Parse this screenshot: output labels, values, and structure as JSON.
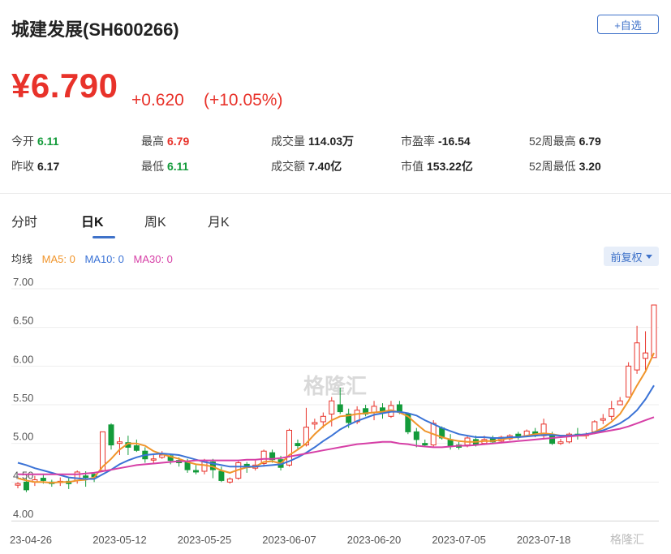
{
  "header": {
    "title": "城建发展(SH600266)",
    "add_button": "+自选"
  },
  "quote": {
    "price": "¥6.790",
    "change": "+0.620",
    "change_pct": "(+10.05%)"
  },
  "stats": [
    {
      "label": "今开",
      "value": "6.11",
      "color": "green"
    },
    {
      "label": "最高",
      "value": "6.79",
      "color": "red"
    },
    {
      "label": "成交量",
      "value": "114.03万",
      "color": "dark"
    },
    {
      "label": "市盈率",
      "value": "-16.54",
      "color": "dark"
    },
    {
      "label": "52周最高",
      "value": "6.79",
      "color": "dark"
    },
    {
      "label": "昨收",
      "value": "6.17",
      "color": "dark"
    },
    {
      "label": "最低",
      "value": "6.11",
      "color": "green"
    },
    {
      "label": "成交额",
      "value": "7.40亿",
      "color": "dark"
    },
    {
      "label": "市值",
      "value": "153.22亿",
      "color": "dark"
    },
    {
      "label": "52周最低",
      "value": "3.20",
      "color": "dark"
    }
  ],
  "tabs": [
    {
      "label": "分时",
      "active": false
    },
    {
      "label": "日K",
      "active": true
    },
    {
      "label": "周K",
      "active": false
    },
    {
      "label": "月K",
      "active": false
    }
  ],
  "ma": {
    "label": "均线",
    "ma5": "MA5: 0",
    "ma10": "MA10: 0",
    "ma30": "MA30: 0"
  },
  "adjust_button": "前复权",
  "watermark": {
    "center": "格隆汇",
    "corner": "格隆汇"
  },
  "colors": {
    "up": "#e8322a",
    "down": "#139b3a",
    "ma5": "#f0952b",
    "ma10": "#3b73d6",
    "ma30": "#d63fa6",
    "accent": "#3f72c9"
  },
  "chart_data": {
    "type": "candlestick",
    "ylim": [
      4.0,
      7.0
    ],
    "y_ticks": [
      "7.00",
      "6.50",
      "6.00",
      "5.50",
      "5.00",
      "4.50",
      "4.00"
    ],
    "x_ticks": [
      {
        "label": "23-04-26",
        "index": 0
      },
      {
        "label": "2023-05-12",
        "index": 12
      },
      {
        "label": "2023-05-25",
        "index": 22
      },
      {
        "label": "2023-06-07",
        "index": 32
      },
      {
        "label": "2023-06-20",
        "index": 42
      },
      {
        "label": "2023-07-05",
        "index": 52
      },
      {
        "label": "2023-07-18",
        "index": 62
      }
    ],
    "candles": [
      [
        4.46,
        4.48,
        4.5,
        4.42
      ],
      [
        4.5,
        4.4,
        4.55,
        4.37
      ],
      [
        4.5,
        4.53,
        4.58,
        4.45
      ],
      [
        4.55,
        4.52,
        4.6,
        4.48
      ],
      [
        4.5,
        4.48,
        4.53,
        4.44
      ],
      [
        4.51,
        4.51,
        4.56,
        4.45
      ],
      [
        4.51,
        4.48,
        4.55,
        4.41
      ],
      [
        4.52,
        4.63,
        4.65,
        4.48
      ],
      [
        4.58,
        4.56,
        4.64,
        4.44
      ],
      [
        4.6,
        4.57,
        4.63,
        4.5
      ],
      [
        4.65,
        5.15,
        5.15,
        4.63
      ],
      [
        5.24,
        4.98,
        5.26,
        4.92
      ],
      [
        5.0,
        5.02,
        5.08,
        4.85
      ],
      [
        5.01,
        4.95,
        5.1,
        4.85
      ],
      [
        4.97,
        4.91,
        5.05,
        4.89
      ],
      [
        4.9,
        4.8,
        4.95,
        4.75
      ],
      [
        4.8,
        4.8,
        4.85,
        4.75
      ],
      [
        4.82,
        4.85,
        4.9,
        4.8
      ],
      [
        4.84,
        4.78,
        4.87,
        4.73
      ],
      [
        4.78,
        4.75,
        4.82,
        4.7
      ],
      [
        4.76,
        4.66,
        4.8,
        4.62
      ],
      [
        4.65,
        4.63,
        4.72,
        4.6
      ],
      [
        4.64,
        4.78,
        4.8,
        4.6
      ],
      [
        4.76,
        4.66,
        4.8,
        4.55
      ],
      [
        4.64,
        4.52,
        4.7,
        4.5
      ],
      [
        4.5,
        4.54,
        4.56,
        4.48
      ],
      [
        4.55,
        4.75,
        4.77,
        4.53
      ],
      [
        4.73,
        4.69,
        4.76,
        4.62
      ],
      [
        4.68,
        4.72,
        4.78,
        4.65
      ],
      [
        4.74,
        4.9,
        4.92,
        4.7
      ],
      [
        4.88,
        4.79,
        4.92,
        4.75
      ],
      [
        4.79,
        4.69,
        4.84,
        4.65
      ],
      [
        4.72,
        5.17,
        5.19,
        4.7
      ],
      [
        5.0,
        4.97,
        5.05,
        4.93
      ],
      [
        4.98,
        5.21,
        5.46,
        4.96
      ],
      [
        5.25,
        5.27,
        5.32,
        5.18
      ],
      [
        5.28,
        5.35,
        5.4,
        5.2
      ],
      [
        5.38,
        5.55,
        5.6,
        5.22
      ],
      [
        5.5,
        5.41,
        5.72,
        5.38
      ],
      [
        5.38,
        5.27,
        5.45,
        5.2
      ],
      [
        5.28,
        5.43,
        5.48,
        5.25
      ],
      [
        5.45,
        5.38,
        5.5,
        5.35
      ],
      [
        5.4,
        5.48,
        5.55,
        5.3
      ],
      [
        5.46,
        5.4,
        5.52,
        5.32
      ],
      [
        5.35,
        5.49,
        5.55,
        5.33
      ],
      [
        5.5,
        5.41,
        5.55,
        5.38
      ],
      [
        5.38,
        5.15,
        5.4,
        5.12
      ],
      [
        5.15,
        5.05,
        5.2,
        4.95
      ],
      [
        5.0,
        4.98,
        5.05,
        4.95
      ],
      [
        4.98,
        5.26,
        5.3,
        4.96
      ],
      [
        5.2,
        5.07,
        5.22,
        5.05
      ],
      [
        5.05,
        4.96,
        5.12,
        4.92
      ],
      [
        4.98,
        4.95,
        5.02,
        4.92
      ],
      [
        4.98,
        5.07,
        5.1,
        4.95
      ],
      [
        5.05,
        4.99,
        5.1,
        4.96
      ],
      [
        5.0,
        5.05,
        5.1,
        4.98
      ]
    ],
    "ma_series": [
      {
        "name": "MA5",
        "values": [
          4.55,
          4.52,
          4.5,
          4.5,
          4.49,
          4.5,
          4.5,
          4.52,
          4.53,
          4.56,
          4.7,
          4.8,
          4.92,
          5.0,
          5.0,
          4.97,
          4.9,
          4.86,
          4.83,
          4.8,
          4.76,
          4.73,
          4.72,
          4.7,
          4.65,
          4.62,
          4.66,
          4.69,
          4.7,
          4.76,
          4.77,
          4.74,
          4.85,
          4.92,
          5.0,
          5.12,
          5.22,
          5.3,
          5.35,
          5.36,
          5.38,
          5.39,
          5.4,
          5.41,
          5.43,
          5.4,
          5.35,
          5.25,
          5.16,
          5.12,
          5.08,
          5.05,
          5.03,
          5.02,
          5.02,
          5.03
        ]
      },
      {
        "name": "MA10",
        "values": [
          4.75,
          4.72,
          4.68,
          4.65,
          4.62,
          4.59,
          4.56,
          4.55,
          4.54,
          4.54,
          4.6,
          4.66,
          4.73,
          4.78,
          4.82,
          4.85,
          4.86,
          4.87,
          4.86,
          4.85,
          4.82,
          4.79,
          4.76,
          4.74,
          4.72,
          4.7,
          4.7,
          4.7,
          4.7,
          4.71,
          4.72,
          4.73,
          4.77,
          4.82,
          4.88,
          4.95,
          5.03,
          5.1,
          5.18,
          5.24,
          5.29,
          5.33,
          5.37,
          5.39,
          5.41,
          5.41,
          5.39,
          5.36,
          5.3,
          5.25,
          5.2,
          5.16,
          5.12,
          5.1,
          5.08,
          5.08
        ]
      },
      {
        "name": "MA30",
        "values": [
          4.6,
          4.6,
          4.6,
          4.6,
          4.6,
          4.6,
          4.6,
          4.6,
          4.61,
          4.62,
          4.64,
          4.66,
          4.68,
          4.7,
          4.72,
          4.73,
          4.74,
          4.75,
          4.76,
          4.77,
          4.77,
          4.78,
          4.78,
          4.78,
          4.78,
          4.78,
          4.78,
          4.79,
          4.79,
          4.8,
          4.8,
          4.81,
          4.83,
          4.85,
          4.87,
          4.89,
          4.91,
          4.93,
          4.95,
          4.97,
          4.99,
          5.0,
          5.01,
          5.02,
          5.02,
          5.0,
          4.99,
          4.97,
          4.96,
          4.95,
          4.95,
          4.96,
          4.97,
          4.97,
          4.98,
          4.99
        ]
      }
    ],
    "tail_candles": [
      [
        5.06,
        5.02,
        5.1,
        5.0
      ],
      [
        5.03,
        5.08,
        5.1,
        5.0
      ],
      [
        5.06,
        5.1,
        5.12,
        5.04
      ],
      [
        5.12,
        5.08,
        5.15,
        5.05
      ],
      [
        5.1,
        5.16,
        5.18,
        5.08
      ],
      [
        5.15,
        5.11,
        5.2,
        5.08
      ],
      [
        5.1,
        5.25,
        5.32,
        5.05
      ],
      [
        5.1,
        5.0,
        5.15,
        4.98
      ],
      [
        5.0,
        5.02,
        5.06,
        4.98
      ],
      [
        5.02,
        5.12,
        5.14,
        5.0
      ],
      [
        5.12,
        5.1,
        5.2,
        5.05
      ],
      [
        5.1,
        5.12,
        5.14,
        5.06
      ],
      [
        5.15,
        5.28,
        5.3,
        5.12
      ],
      [
        5.3,
        5.32,
        5.38,
        5.25
      ],
      [
        5.35,
        5.45,
        5.55,
        5.3
      ],
      [
        5.5,
        5.55,
        5.6,
        5.5
      ],
      [
        5.6,
        6.0,
        6.05,
        5.9
      ],
      [
        5.95,
        6.3,
        6.52,
        5.9
      ],
      [
        6.1,
        6.17,
        6.45,
        5.95
      ],
      [
        6.11,
        6.79,
        6.79,
        6.11
      ]
    ]
  }
}
